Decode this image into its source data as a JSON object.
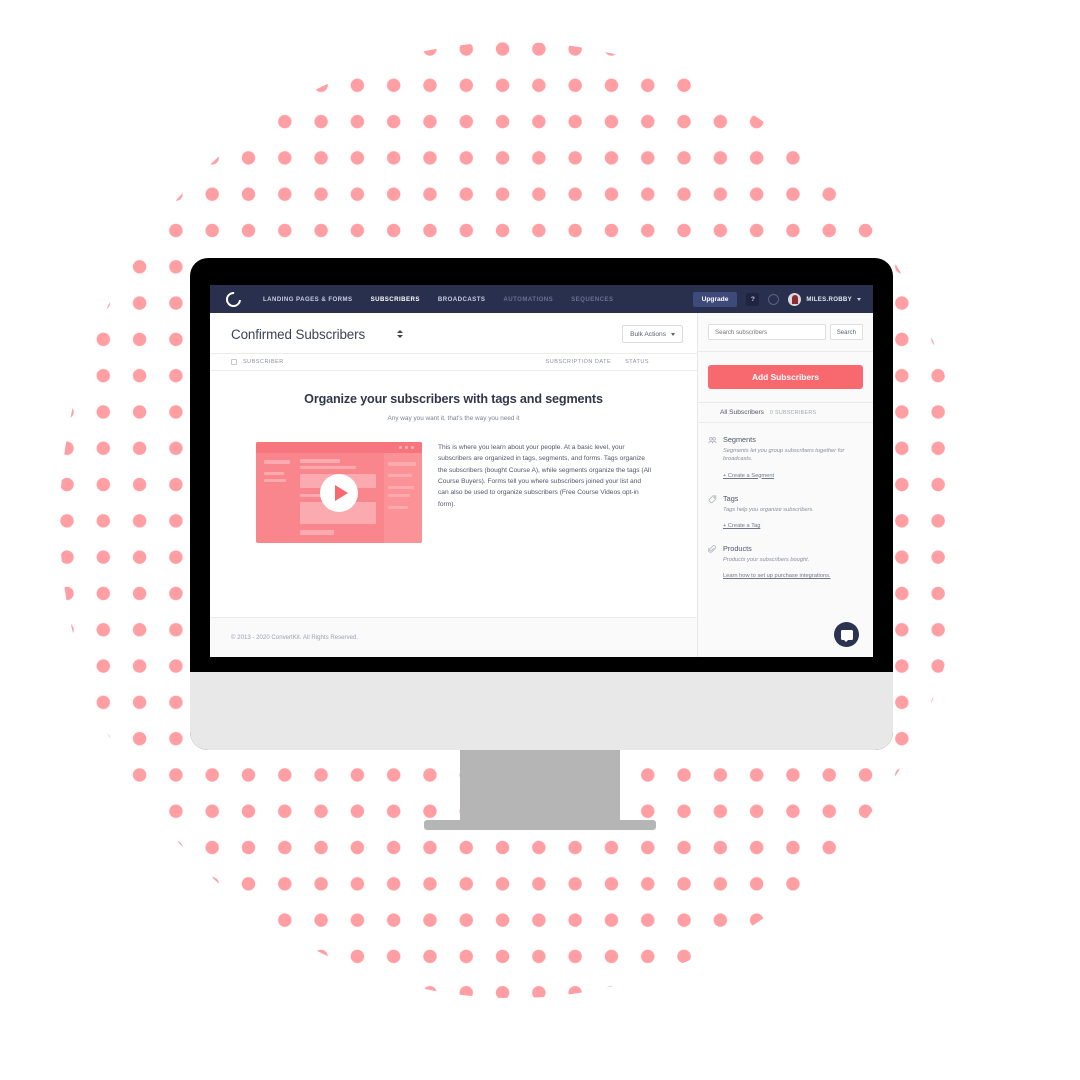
{
  "nav": {
    "logo": "convertkit-logo-icon",
    "links": [
      {
        "label": "LANDING PAGES & FORMS",
        "state": "normal"
      },
      {
        "label": "SUBSCRIBERS",
        "state": "active"
      },
      {
        "label": "BROADCASTS",
        "state": "normal"
      },
      {
        "label": "AUTOMATIONS",
        "state": "dim"
      },
      {
        "label": "SEQUENCES",
        "state": "dim"
      }
    ],
    "upgrade_label": "Upgrade",
    "help_label": "?",
    "user_name": "MILES.ROBBY"
  },
  "page": {
    "title": "Confirmed Subscribers",
    "bulk_actions_label": "Bulk Actions"
  },
  "table": {
    "columns": {
      "subscriber": "SUBSCRIBER",
      "subscription_date": "SUBSCRIPTION DATE",
      "status": "STATUS"
    }
  },
  "empty_state": {
    "heading": "Organize your subscribers with tags and segments",
    "subheading": "Any way you want it, that's the way you need it",
    "body": "This is where you learn about your people. At a basic level, your subscribers are organized in tags, segments, and forms. Tags organize the subscribers (bought Course A), while segments organize the tags (All Course Buyers). Forms tell you where subscribers joined your list and can also be used to organize subscribers (Free Course Videos opt-in form)."
  },
  "footer": {
    "copyright": "© 2013 - 2020 ConvertKit. All Rights Reserved."
  },
  "sidebar": {
    "search_placeholder": "Search subscribers",
    "search_value": "",
    "search_button": "Search",
    "add_subscribers": "Add Subscribers",
    "all_subscribers_label": "All Subscribers",
    "all_subscribers_count": "0 SUBSCRIBERS",
    "sections": [
      {
        "icon": "segments-icon",
        "title": "Segments",
        "description": "Segments let you group subscribers together for broadcasts.",
        "link": "+ Create a Segment"
      },
      {
        "icon": "tag-icon",
        "title": "Tags",
        "description": "Tags help you organize subscribers.",
        "link": "+ Create a Tag"
      },
      {
        "icon": "products-icon",
        "title": "Products",
        "description": "Products your subscribers bought.",
        "link": "Learn how to set up purchase integrations."
      }
    ]
  },
  "chat": {
    "icon": "chat-bubble-icon"
  },
  "colors": {
    "nav_bg": "#29304d",
    "accent": "#f8686f",
    "dot_pink": "#FF9EA3",
    "bezel": "#000000",
    "chin": "#e8e8e8",
    "stand": "#b5b5b5"
  }
}
